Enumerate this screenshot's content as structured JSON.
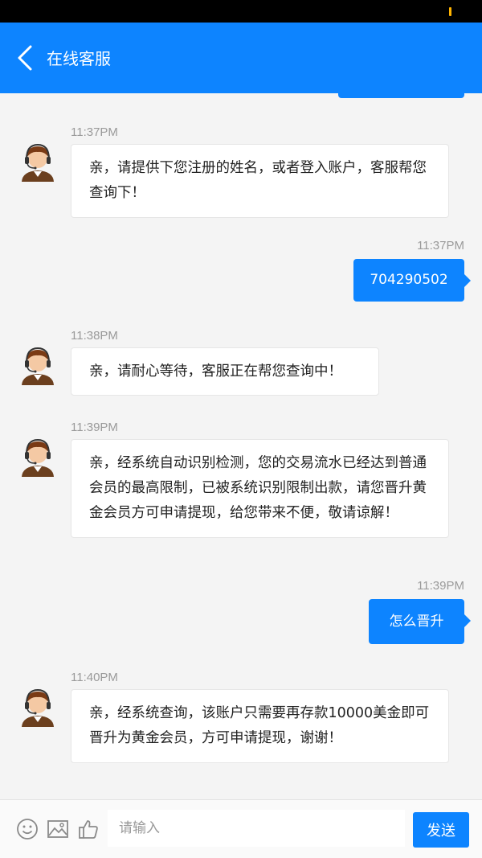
{
  "header": {
    "title": "在线客服",
    "back_icon": "chevron-left-icon"
  },
  "colors": {
    "accent": "#0d84ff",
    "background": "#f4f4f4",
    "status_dot": "#ffb300"
  },
  "messages": [
    {
      "direction": "in",
      "time": "11:37PM",
      "text": "亲，请提供下您注册的姓名，或者登入账户，客服帮您查询下！"
    },
    {
      "direction": "out",
      "time": "11:37PM",
      "text": "704290502"
    },
    {
      "direction": "in",
      "time": "11:38PM",
      "text": "亲，请耐心等待，客服正在帮您查询中！"
    },
    {
      "direction": "in",
      "time": "11:39PM",
      "text": "亲，经系统自动识别检测，您的交易流水已经达到普通会员的最高限制，已被系统识别限制出款，请您晋升黄金会员方可申请提现，给您带来不便，敬请谅解！"
    },
    {
      "direction": "out",
      "time": "11:39PM",
      "text": "怎么晋升"
    },
    {
      "direction": "in",
      "time": "11:40PM",
      "text": "亲，经系统查询，该账户只需要再存款10000美金即可晋升为黄金会员，方可申请提现，谢谢！"
    }
  ],
  "input_bar": {
    "placeholder": "请输入",
    "send_label": "发送",
    "icons": [
      "emoji-icon",
      "image-icon",
      "thumbs-up-icon"
    ]
  }
}
